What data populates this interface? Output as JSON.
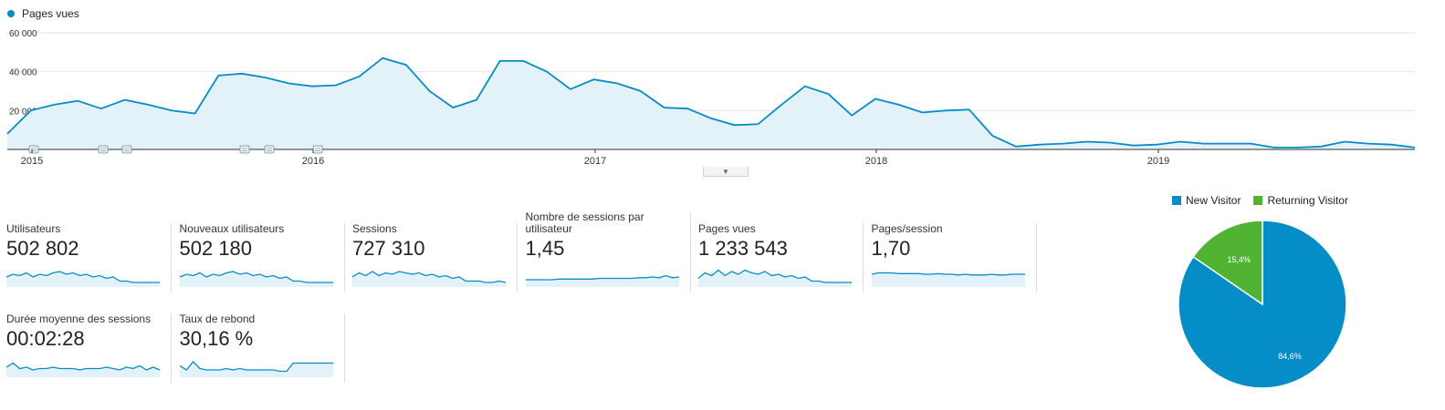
{
  "main_chart": {
    "legend_label": "Pages vues",
    "series_color": "#058dc7",
    "y_ticks": [
      "60 000",
      "40 000",
      "20 000"
    ],
    "x_labels": [
      "2015",
      "2016",
      "2017",
      "2018",
      "2019"
    ]
  },
  "chart_data": [
    {
      "type": "area",
      "series": [
        {
          "name": "Pages vues",
          "values": [
            8000,
            20000,
            23000,
            25000,
            21000,
            25500,
            23000,
            20000,
            18500,
            38000,
            39000,
            37000,
            34000,
            32500,
            33000,
            37500,
            47000,
            43500,
            30000,
            21500,
            25500,
            45500,
            45500,
            40000,
            31000,
            36000,
            34000,
            30000,
            21500,
            21000,
            16000,
            12500,
            13000,
            23000,
            32500,
            28500,
            17500,
            26000,
            23000,
            19000,
            20000,
            20500,
            7000,
            1500,
            2500,
            3000,
            4000,
            3500,
            2000,
            2500,
            4000,
            3000,
            3000,
            3000,
            1000,
            1000,
            1500,
            4000,
            3000,
            2500,
            1000
          ]
        }
      ],
      "x_range": [
        "2015",
        "2019"
      ],
      "ylim": [
        0,
        60000
      ],
      "y_ticks": [
        20000,
        40000,
        60000
      ],
      "grid": true,
      "legend_position": "top-left"
    },
    {
      "type": "pie",
      "labels": [
        "New Visitor",
        "Returning Visitor"
      ],
      "values": [
        84.6,
        15.4
      ],
      "value_labels": [
        "84,6%",
        "15,4%"
      ],
      "colors": [
        "#058dc7",
        "#50b432"
      ],
      "legend_position": "top"
    }
  ],
  "metrics": [
    {
      "label": "Utilisateurs",
      "value": "502 802",
      "spark": [
        6,
        8,
        7,
        9,
        6,
        8,
        7,
        9,
        10,
        8,
        9,
        7,
        8,
        6,
        7,
        5,
        6,
        3,
        3,
        2,
        2,
        2,
        2,
        2
      ]
    },
    {
      "label": "Nouveaux utilisateurs",
      "value": "502 180",
      "spark": [
        6,
        8,
        7,
        9,
        6,
        8,
        7,
        9,
        10,
        8,
        9,
        7,
        8,
        6,
        7,
        5,
        6,
        3,
        3,
        2,
        2,
        2,
        2,
        2
      ]
    },
    {
      "label": "Sessions",
      "value": "727 310",
      "spark": [
        6,
        9,
        7,
        10,
        7,
        9,
        8,
        10,
        9,
        8,
        9,
        7,
        8,
        6,
        7,
        5,
        6,
        3,
        3,
        3,
        2,
        2,
        3,
        2
      ]
    },
    {
      "label": "Nombre de sessions par utilisateur",
      "value": "1,45",
      "spark": [
        4,
        4,
        4,
        4,
        4,
        4.5,
        4.5,
        4.5,
        4.5,
        4.5,
        4.5,
        5,
        5,
        5,
        5,
        5,
        5,
        5.5,
        5.5,
        6,
        5.5,
        7,
        5.5,
        6
      ]
    },
    {
      "label": "Pages vues",
      "value": "1 233 543",
      "spark": [
        5,
        9,
        7,
        11,
        7,
        10,
        8,
        11,
        9,
        8,
        10,
        7,
        8,
        6,
        7,
        5,
        6,
        3,
        3,
        2,
        2,
        2,
        2,
        2
      ]
    },
    {
      "label": "Pages/session",
      "value": "1,70",
      "spark": [
        8,
        9,
        9,
        9,
        8.5,
        8.5,
        8.5,
        8.5,
        8,
        8,
        8.5,
        8,
        8,
        7.5,
        8,
        7.5,
        7.5,
        7.5,
        8,
        7.5,
        7.5,
        8,
        8,
        8
      ]
    },
    {
      "label": "Durée moyenne des sessions",
      "value": "00:02:28",
      "spark": [
        6,
        9,
        5,
        6,
        4,
        5,
        5,
        6,
        5,
        5,
        5,
        4,
        5,
        5,
        5,
        6,
        5,
        4,
        6,
        5,
        7,
        4,
        6,
        4
      ]
    },
    {
      "label": "Taux de rebond",
      "value": "30,16 %",
      "spark": [
        7,
        4,
        10,
        5,
        4,
        4,
        4,
        5,
        4,
        5,
        4,
        4,
        4,
        4,
        4,
        3,
        3,
        9,
        9,
        9,
        9,
        9,
        9,
        9
      ]
    }
  ]
}
